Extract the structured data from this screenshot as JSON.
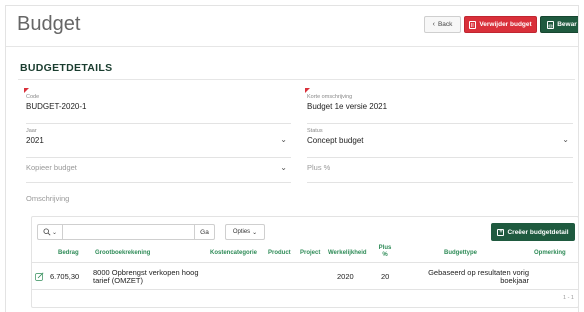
{
  "header": {
    "title": "Budget",
    "back_label": "Back",
    "delete_label": "Verwijder budget",
    "save_label": "Bewar"
  },
  "section": {
    "title": "BUDGETDETAILS"
  },
  "form": {
    "code": {
      "label": "Code",
      "value": "BUDGET-2020-1"
    },
    "korte_omschrijving": {
      "label": "Korte omschrijving",
      "value": "Budget 1e versie 2021"
    },
    "jaar": {
      "label": "Jaar",
      "value": "2021"
    },
    "status": {
      "label": "Status",
      "value": "Concept budget"
    },
    "kopieer_budget": {
      "placeholder": "Kopieer budget"
    },
    "plus_pct": {
      "placeholder": "Plus %"
    },
    "omschrijving": {
      "placeholder": "Omschrijving"
    }
  },
  "toolbar": {
    "go_label": "Ga",
    "options_label": "Opties",
    "create_label": "Creëer budgetdetail"
  },
  "table": {
    "columns": [
      "Bedrag",
      "Grootboekrekening",
      "Kostencategorie",
      "Product",
      "Project",
      "Werkelijkheid",
      "Plus %",
      "Budgettype",
      "Opmerking"
    ],
    "rows": [
      {
        "bedrag": "6.705,30",
        "grootboek": "8000 Opbrengst verkopen hoog tarief (OMZET)",
        "kostencategorie": "",
        "product": "",
        "project": "",
        "werkelijkheid": "2020",
        "plus": "20",
        "budgettype": "Gebaseerd op resultaten vorig boekjaar",
        "opmerking": ""
      }
    ],
    "pager": "1 - 1"
  },
  "colors": {
    "accent_green": "#1f5a3f",
    "header_green": "#2e8b57",
    "danger_red": "#d9303a"
  }
}
